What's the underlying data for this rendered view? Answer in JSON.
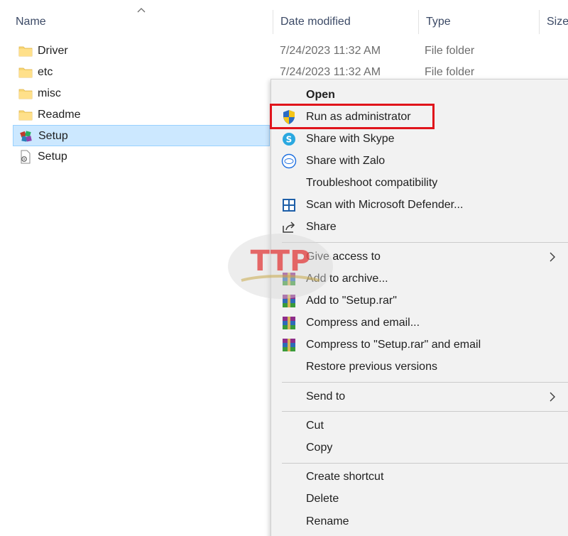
{
  "columns": {
    "name": "Name",
    "date_modified": "Date modified",
    "type": "Type",
    "size": "Size"
  },
  "files": [
    {
      "name": "Driver",
      "date": "7/24/2023 11:32 AM",
      "type": "File folder",
      "icon": "folder-icon"
    },
    {
      "name": "etc",
      "date": "7/24/2023 11:32 AM",
      "type": "File folder",
      "icon": "folder-icon"
    },
    {
      "name": "misc",
      "date": "",
      "type": "",
      "icon": "folder-icon"
    },
    {
      "name": "Readme",
      "date": "",
      "type": "",
      "icon": "folder-icon"
    },
    {
      "name": "Setup",
      "date": "",
      "type": "",
      "icon": "installer-icon",
      "selected": true
    },
    {
      "name": "Setup",
      "date": "",
      "type": "",
      "icon": "config-file-icon"
    }
  ],
  "context_menu": {
    "items": [
      {
        "label": "Open",
        "bold": true
      },
      {
        "label": "Run as administrator",
        "icon": "uac-shield-icon",
        "highlighted": true
      },
      {
        "label": "Share with Skype",
        "icon": "skype-icon"
      },
      {
        "label": "Share with Zalo",
        "icon": "zalo-icon"
      },
      {
        "label": "Troubleshoot compatibility"
      },
      {
        "label": "Scan with Microsoft Defender...",
        "icon": "defender-icon"
      },
      {
        "label": "Share",
        "icon": "share-icon"
      },
      {
        "label": "Give access to",
        "submenu": true
      },
      {
        "label": "Add to archive...",
        "icon": "winrar-icon"
      },
      {
        "label": "Add to \"Setup.rar\"",
        "icon": "winrar-icon"
      },
      {
        "label": "Compress and email...",
        "icon": "winrar-icon"
      },
      {
        "label": "Compress to \"Setup.rar\" and email",
        "icon": "winrar-icon"
      },
      {
        "label": "Restore previous versions"
      },
      {
        "label": "Send to",
        "submenu": true
      },
      {
        "label": "Cut"
      },
      {
        "label": "Copy"
      },
      {
        "label": "Create shortcut"
      },
      {
        "label": "Delete"
      },
      {
        "label": "Rename"
      }
    ]
  },
  "watermark": {
    "text": "TTP"
  },
  "colors": {
    "selection_bg": "#cce8ff",
    "selection_border": "#99d1ff",
    "highlight_border": "#e0141b",
    "menu_bg": "#f2f2f2"
  }
}
